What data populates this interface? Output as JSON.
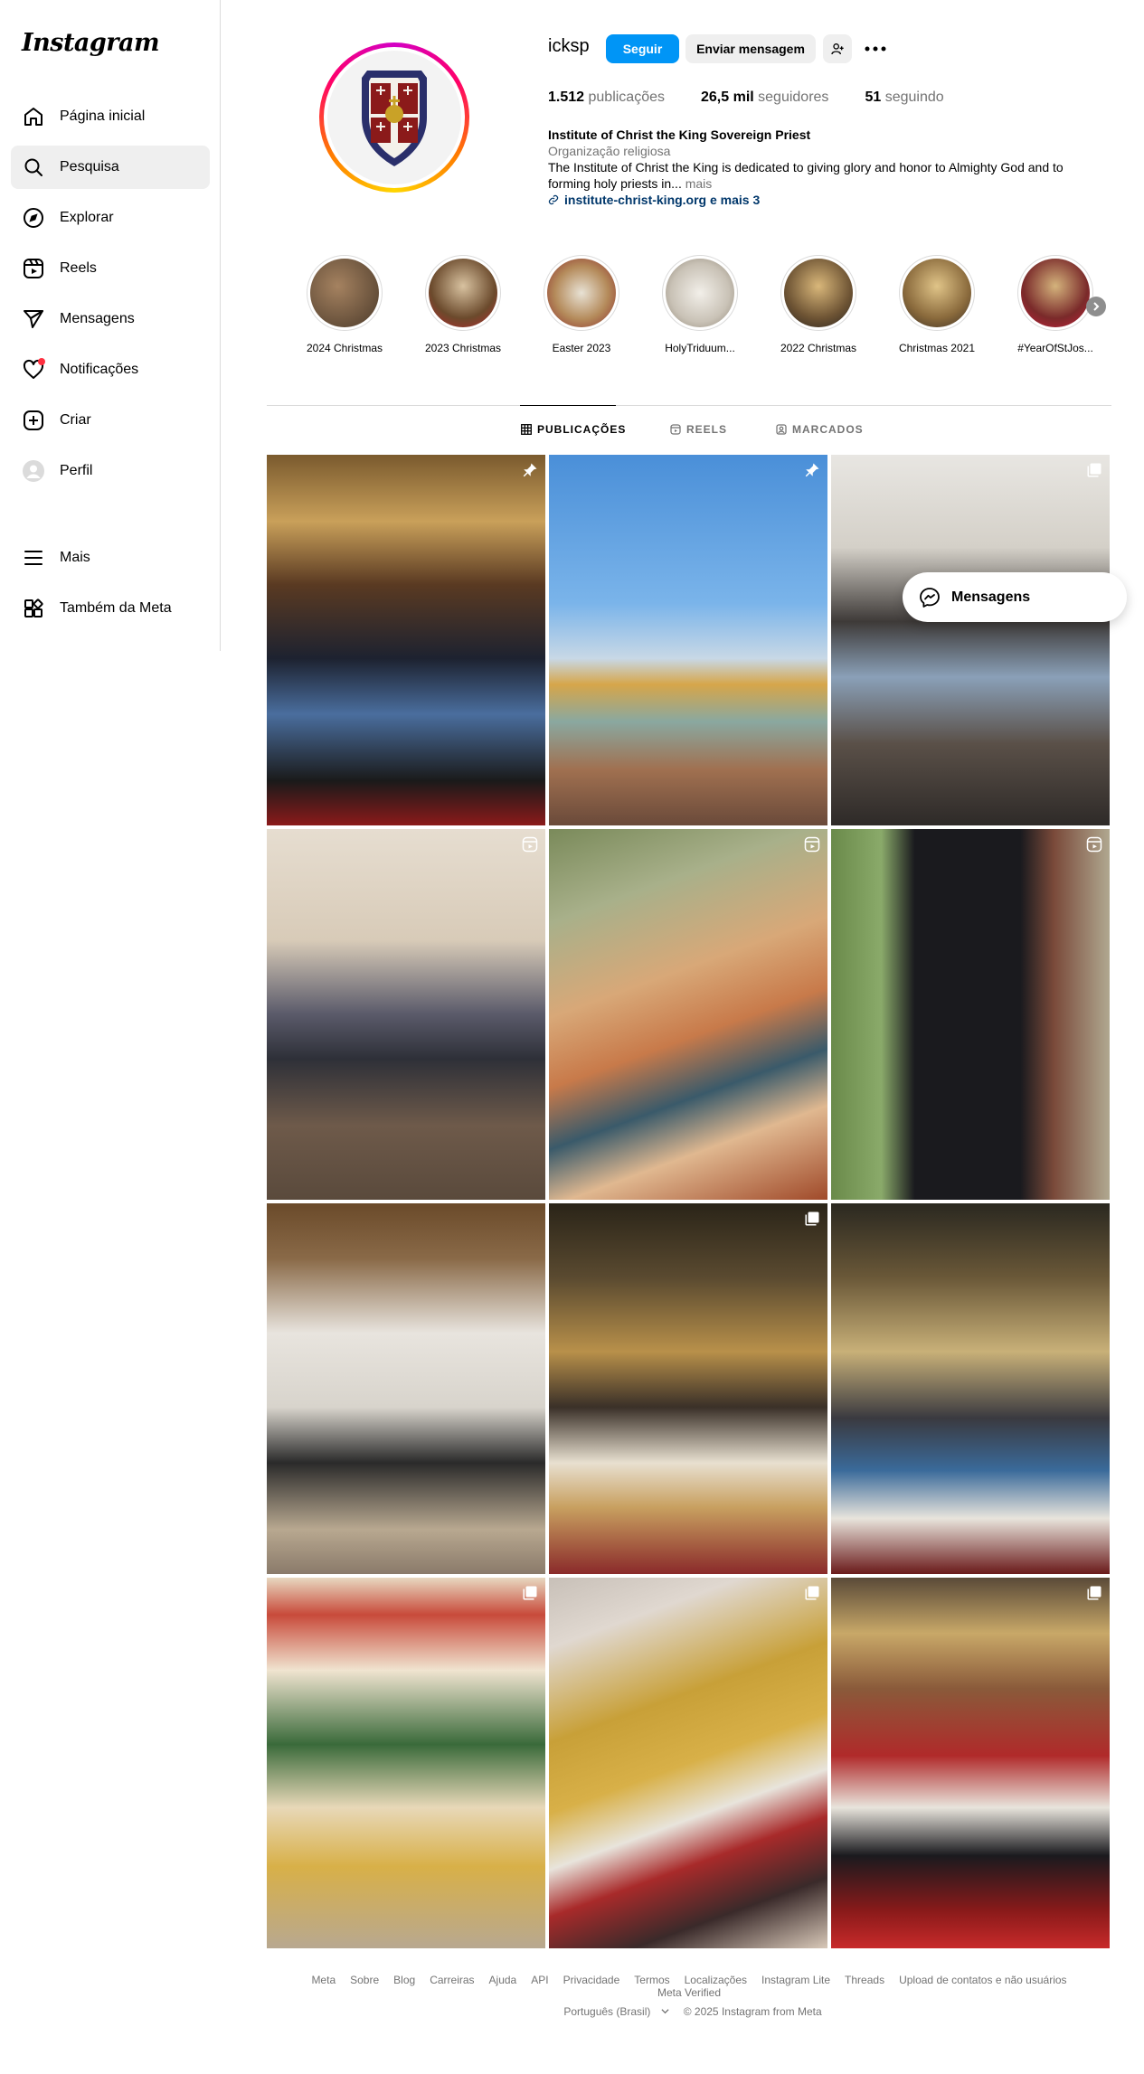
{
  "app": {
    "logo": "Instagram"
  },
  "sidebar": {
    "items": [
      {
        "label": "Página inicial",
        "icon": "home-icon"
      },
      {
        "label": "Pesquisa",
        "icon": "search-icon"
      },
      {
        "label": "Explorar",
        "icon": "explore-icon"
      },
      {
        "label": "Reels",
        "icon": "reels-icon"
      },
      {
        "label": "Mensagens",
        "icon": "messages-icon"
      },
      {
        "label": "Notificações",
        "icon": "heart-icon"
      },
      {
        "label": "Criar",
        "icon": "create-icon"
      },
      {
        "label": "Perfil",
        "icon": "profile-icon"
      }
    ],
    "more": "Mais",
    "meta": "Também da Meta",
    "active": "Pesquisa"
  },
  "profile": {
    "username": "icksp",
    "follow_label": "Seguir",
    "message_label": "Enviar mensagem",
    "stats": {
      "posts_value": "1.512",
      "posts_label": "publicações",
      "followers_value": "26,5 mil",
      "followers_label": "seguidores",
      "following_value": "51",
      "following_label": "seguindo"
    },
    "name": "Institute of Christ the King Sovereign Priest",
    "category": "Organização religiosa",
    "bio_text": "The Institute of Christ the King is dedicated to giving glory and honor to Almighty God and to forming holy priests in...",
    "bio_more": "mais",
    "link": "institute-christ-king.org e mais 3"
  },
  "highlights": [
    "2024 Christmas",
    "2023 Christmas",
    "Easter 2023",
    "HolyTriduum...",
    "2022 Christmas",
    "Christmas 2021",
    "#YearOfStJos..."
  ],
  "tabs": [
    "PUBLICAÇÕES",
    "REELS",
    "MARCADOS"
  ],
  "active_tab": "PUBLICAÇÕES",
  "posts": [
    {
      "desc": "clergy choir group photo",
      "badge": "pin-icon"
    },
    {
      "desc": "city basilica skyline",
      "badge": "pin-icon"
    },
    {
      "desc": "sisters with girls at tables",
      "badge": "carousel-icon"
    },
    {
      "desc": "church aisle procession",
      "badge": "reel-icon"
    },
    {
      "desc": "fresco of saints",
      "badge": "reel-icon"
    },
    {
      "desc": "priest in black cape",
      "badge": "reel-icon"
    },
    {
      "desc": "church renovation",
      "badge": ""
    },
    {
      "desc": "ornate church interior",
      "badge": "carousel-icon"
    },
    {
      "desc": "ordination ceremony",
      "badge": ""
    },
    {
      "desc": "altar with garland",
      "badge": "carousel-icon"
    },
    {
      "desc": "priests in gold vestments",
      "badge": "carousel-icon"
    },
    {
      "desc": "altar ceremony",
      "badge": "carousel-icon"
    }
  ],
  "floating_messages": "Mensagens",
  "footer": {
    "links": [
      "Meta",
      "Sobre",
      "Blog",
      "Carreiras",
      "Ajuda",
      "API",
      "Privacidade",
      "Termos",
      "Localizações",
      "Instagram Lite",
      "Threads",
      "Upload de contatos e não usuários",
      "Meta Verified"
    ],
    "language": "Português (Brasil)",
    "copyright": "© 2025 Instagram from Meta"
  },
  "colors": {
    "primary": "#0095f6",
    "link": "#00376b",
    "muted": "#737373",
    "notify": "#ff3040"
  }
}
